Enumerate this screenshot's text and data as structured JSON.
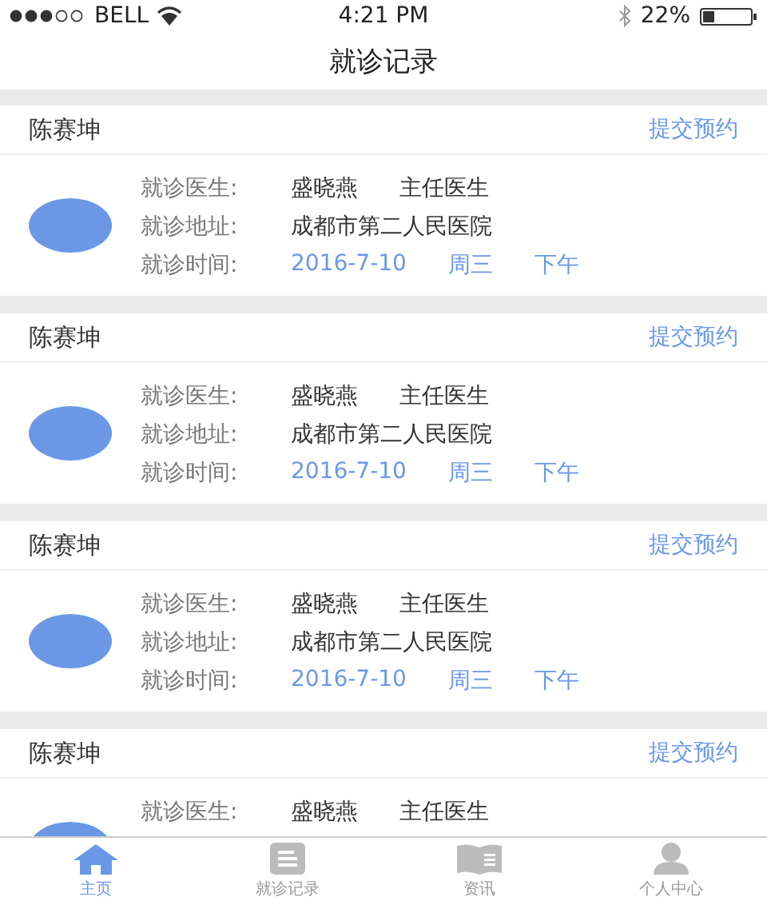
{
  "status_bar": {
    "carrier": "BELL",
    "time": "4:21 PM",
    "battery": "22%"
  },
  "header": {
    "title": "就诊记录"
  },
  "records": [
    {
      "patient": "陈赛坤",
      "action": "提交预约",
      "rows": [
        {
          "label": "就诊医生:",
          "values": [
            {
              "text": "盛晓燕",
              "kind": "plain"
            },
            {
              "text": "主任医生",
              "kind": "plain"
            }
          ]
        },
        {
          "label": "就诊地址:",
          "values": [
            {
              "text": "成都市第二人民医院",
              "kind": "plain"
            }
          ]
        },
        {
          "label": "就诊时间:",
          "values": [
            {
              "text": "2016-7-10",
              "kind": "accent"
            },
            {
              "text": "周三",
              "kind": "accent"
            },
            {
              "text": "下午",
              "kind": "accent"
            }
          ]
        }
      ]
    },
    {
      "patient": "陈赛坤",
      "action": "提交预约",
      "rows": [
        {
          "label": "就诊医生:",
          "values": [
            {
              "text": "盛晓燕",
              "kind": "plain"
            },
            {
              "text": "主任医生",
              "kind": "plain"
            }
          ]
        },
        {
          "label": "就诊地址:",
          "values": [
            {
              "text": "成都市第二人民医院",
              "kind": "plain"
            }
          ]
        },
        {
          "label": "就诊时间:",
          "values": [
            {
              "text": "2016-7-10",
              "kind": "accent"
            },
            {
              "text": "周三",
              "kind": "accent"
            },
            {
              "text": "下午",
              "kind": "accent"
            }
          ]
        }
      ]
    },
    {
      "patient": "陈赛坤",
      "action": "提交预约",
      "rows": [
        {
          "label": "就诊医生:",
          "values": [
            {
              "text": "盛晓燕",
              "kind": "plain"
            },
            {
              "text": "主任医生",
              "kind": "plain"
            }
          ]
        },
        {
          "label": "就诊地址:",
          "values": [
            {
              "text": "成都市第二人民医院",
              "kind": "plain"
            }
          ]
        },
        {
          "label": "就诊时间:",
          "values": [
            {
              "text": "2016-7-10",
              "kind": "accent"
            },
            {
              "text": "周三",
              "kind": "accent"
            },
            {
              "text": "下午",
              "kind": "accent"
            }
          ]
        }
      ]
    },
    {
      "patient": "陈赛坤",
      "action": "提交预约",
      "rows": [
        {
          "label": "就诊医生:",
          "values": [
            {
              "text": "盛晓燕",
              "kind": "plain"
            },
            {
              "text": "主任医生",
              "kind": "plain"
            }
          ]
        }
      ]
    }
  ],
  "tab_bar": [
    {
      "label": "主页",
      "kind": "home",
      "selected": true
    },
    {
      "label": "就诊记录",
      "kind": "list",
      "selected": false
    },
    {
      "label": "资讯",
      "kind": "book",
      "selected": false
    },
    {
      "label": "个人中心",
      "kind": "person",
      "selected": false
    }
  ]
}
